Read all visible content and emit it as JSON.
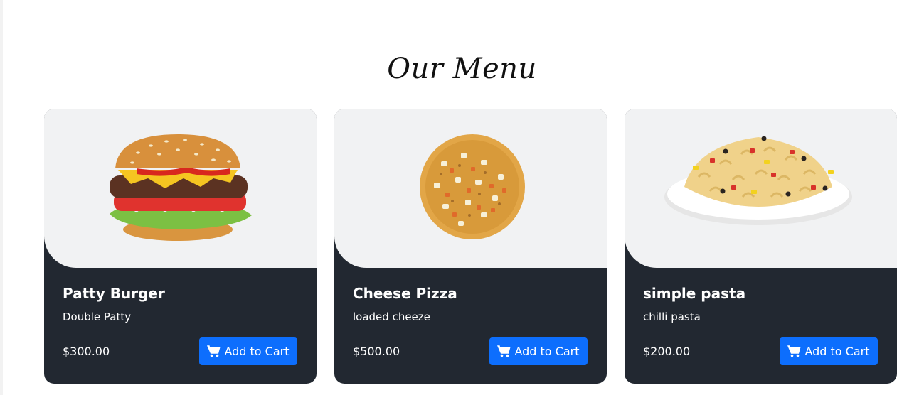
{
  "section": {
    "title": "Our Menu"
  },
  "menu_items": [
    {
      "name": "Patty Burger",
      "description": "Double Patty",
      "price": "$300.00",
      "button_label": "Add to Cart",
      "image": "burger-image"
    },
    {
      "name": "Cheese Pizza",
      "description": "loaded cheeze",
      "price": "$500.00",
      "button_label": "Add to Cart",
      "image": "pizza-image"
    },
    {
      "name": "simple pasta",
      "description": "chilli pasta",
      "price": "$200.00",
      "button_label": "Add to Cart",
      "image": "pasta-image"
    }
  ],
  "colors": {
    "card_background": "#222831",
    "image_background": "#f1f2f3",
    "button": "#0d6efd"
  },
  "icons": {
    "cart": "cart-icon"
  }
}
